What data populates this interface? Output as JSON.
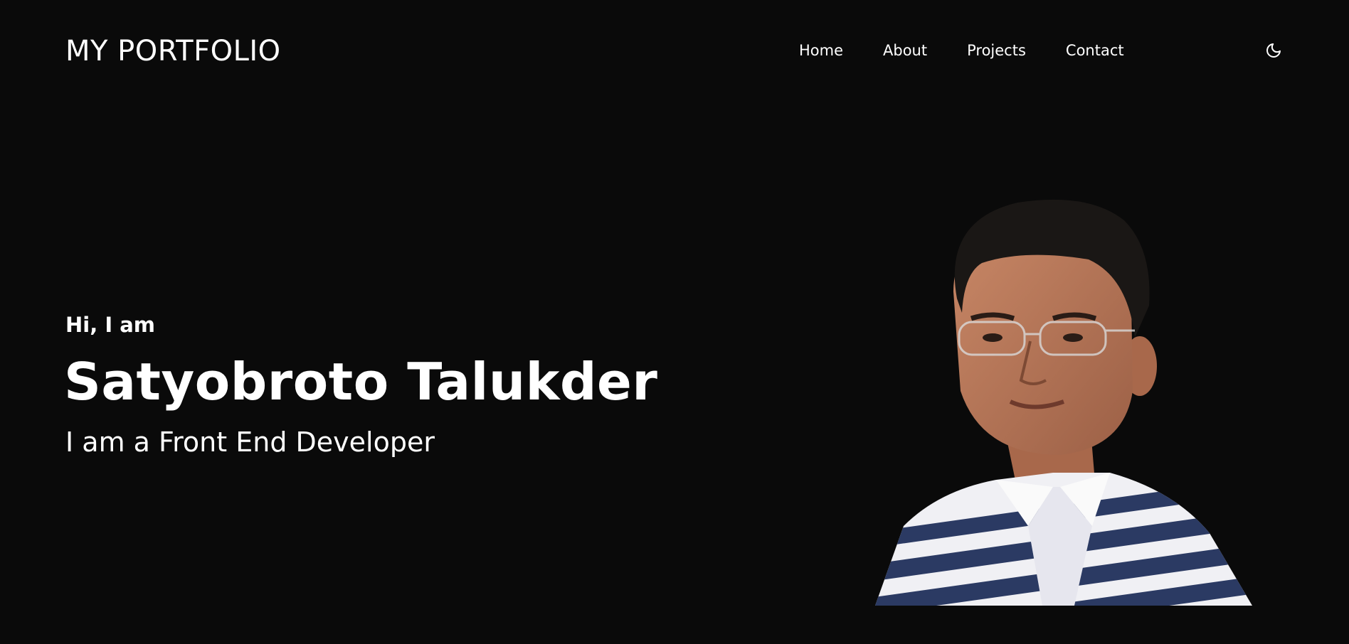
{
  "header": {
    "logo": "MY PORTFOLIO",
    "nav": [
      {
        "label": "Home"
      },
      {
        "label": "About"
      },
      {
        "label": "Projects"
      },
      {
        "label": "Contact"
      }
    ],
    "theme_toggle_icon": "moon-icon"
  },
  "hero": {
    "greeting": "Hi, I am",
    "name": "Satyobroto Talukder",
    "role": "I am a Front End Developer"
  },
  "colors": {
    "background": "#0a0a0a",
    "text": "#ffffff",
    "shirt_stripe": "#2b3a63"
  }
}
